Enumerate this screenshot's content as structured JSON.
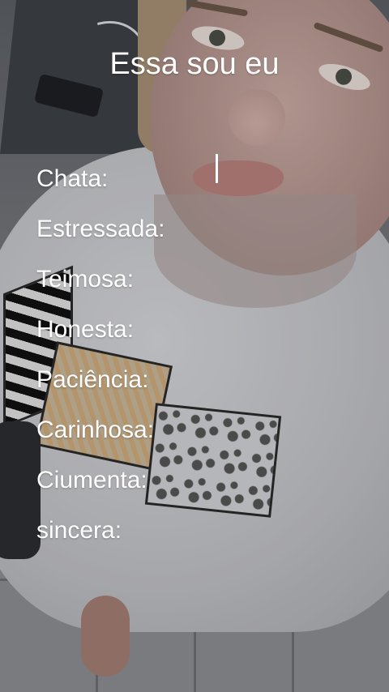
{
  "story": {
    "title": "Essa sou eu",
    "items": [
      {
        "label": "Chata:"
      },
      {
        "label": "Estressada:"
      },
      {
        "label": "Teimosa:"
      },
      {
        "label": "Honesta:"
      },
      {
        "label": "Paciência:"
      },
      {
        "label": "Carinhosa:"
      },
      {
        "label": "Ciumenta:"
      },
      {
        "label": "sincera:"
      }
    ]
  },
  "colors": {
    "text": "#ffffff"
  }
}
